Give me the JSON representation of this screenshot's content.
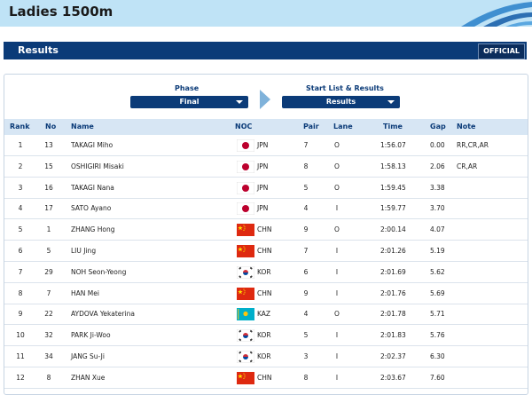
{
  "page": {
    "title": "Ladies 1500m"
  },
  "results_bar": {
    "label": "Results",
    "official_badge": "OFFICIAL"
  },
  "phase": {
    "label": "Phase",
    "value": "Final"
  },
  "start_list": {
    "label": "Start List & Results",
    "value": "Results"
  },
  "columns": {
    "rank": "Rank",
    "no": "No",
    "name": "Name",
    "noc": "NOC",
    "pair": "Pair",
    "lane": "Lane",
    "time": "Time",
    "gap": "Gap",
    "note": "Note"
  },
  "rows": [
    {
      "rank": "1",
      "no": "13",
      "name": "TAKAGI Miho",
      "flag": "jpn",
      "noc": "JPN",
      "pair": "7",
      "lane": "O",
      "time": "1:56.07",
      "gap": "0.00",
      "note": "RR,CR,AR"
    },
    {
      "rank": "2",
      "no": "15",
      "name": "OSHIGIRI Misaki",
      "flag": "jpn",
      "noc": "JPN",
      "pair": "8",
      "lane": "O",
      "time": "1:58.13",
      "gap": "2.06",
      "note": "CR,AR"
    },
    {
      "rank": "3",
      "no": "16",
      "name": "TAKAGI Nana",
      "flag": "jpn",
      "noc": "JPN",
      "pair": "5",
      "lane": "O",
      "time": "1:59.45",
      "gap": "3.38",
      "note": ""
    },
    {
      "rank": "4",
      "no": "17",
      "name": "SATO Ayano",
      "flag": "jpn",
      "noc": "JPN",
      "pair": "4",
      "lane": "I",
      "time": "1:59.77",
      "gap": "3.70",
      "note": ""
    },
    {
      "rank": "5",
      "no": "1",
      "name": "ZHANG Hong",
      "flag": "chn",
      "noc": "CHN",
      "pair": "9",
      "lane": "O",
      "time": "2:00.14",
      "gap": "4.07",
      "note": ""
    },
    {
      "rank": "6",
      "no": "5",
      "name": "LIU Jing",
      "flag": "chn",
      "noc": "CHN",
      "pair": "7",
      "lane": "I",
      "time": "2:01.26",
      "gap": "5.19",
      "note": ""
    },
    {
      "rank": "7",
      "no": "29",
      "name": "NOH Seon-Yeong",
      "flag": "kor",
      "noc": "KOR",
      "pair": "6",
      "lane": "I",
      "time": "2:01.69",
      "gap": "5.62",
      "note": ""
    },
    {
      "rank": "8",
      "no": "7",
      "name": "HAN Mei",
      "flag": "chn",
      "noc": "CHN",
      "pair": "9",
      "lane": "I",
      "time": "2:01.76",
      "gap": "5.69",
      "note": ""
    },
    {
      "rank": "9",
      "no": "22",
      "name": "AYDOVA Yekaterina",
      "flag": "kaz",
      "noc": "KAZ",
      "pair": "4",
      "lane": "O",
      "time": "2:01.78",
      "gap": "5.71",
      "note": ""
    },
    {
      "rank": "10",
      "no": "32",
      "name": "PARK Ji-Woo",
      "flag": "kor",
      "noc": "KOR",
      "pair": "5",
      "lane": "I",
      "time": "2:01.83",
      "gap": "5.76",
      "note": ""
    },
    {
      "rank": "11",
      "no": "34",
      "name": "JANG Su-Ji",
      "flag": "kor",
      "noc": "KOR",
      "pair": "3",
      "lane": "I",
      "time": "2:02.37",
      "gap": "6.30",
      "note": ""
    },
    {
      "rank": "12",
      "no": "8",
      "name": "ZHAN Xue",
      "flag": "chn",
      "noc": "CHN",
      "pair": "8",
      "lane": "I",
      "time": "2:03.67",
      "gap": "7.60",
      "note": ""
    }
  ],
  "colors": {
    "header_bg": "#bfe3f6",
    "bar_navy": "#0b3b78",
    "table_head": "#d7e6f4",
    "jpn_red": "#bc002d",
    "chn_red": "#de2910",
    "kaz_blue": "#00afca"
  }
}
